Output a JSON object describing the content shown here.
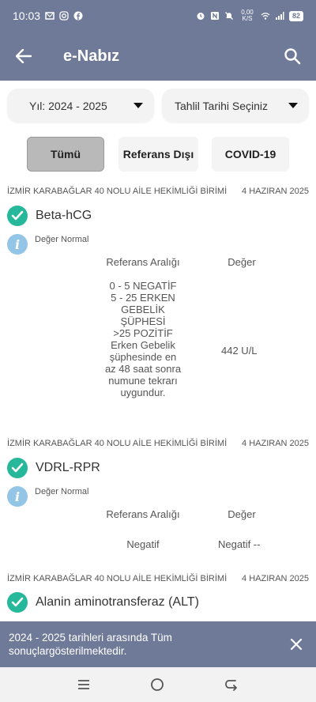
{
  "status": {
    "time": "10:03",
    "speed": "0,00 K/S",
    "battery": "82"
  },
  "app_bar": {
    "title": "e-Nabız"
  },
  "filters": {
    "year": "Yıl: 2024 - 2025",
    "date": "Tahlil Tarihi Seçiniz"
  },
  "tabs": [
    {
      "label": "Tümü",
      "active": true
    },
    {
      "label": "Referans Dışı",
      "active": false
    },
    {
      "label": "COVID-19",
      "active": false
    }
  ],
  "results": [
    {
      "clinic": "İZMİR KARABAĞLAR 40 NOLU AİLE HEKİMLİĞİ BİRİMİ",
      "date": "4 HAZIRAN 2025",
      "test": "Beta-hCG",
      "status": "Değer Normal",
      "ref_header": "Referans Aralığı",
      "value_header": "Değer",
      "reference": "0 - 5  NEGATİF\n5 - 25 ERKEN\nGEBELİK\nŞÜPHESİ\n>25    POZİTİF\nErken Gebelik\nşüphesinde en\naz 48 saat sonra\nnumune tekrarı\nuygundur.",
      "value": "442  U/L"
    },
    {
      "clinic": "İZMİR KARABAĞLAR 40 NOLU AİLE HEKİMLİĞİ BİRİMİ",
      "date": "4 HAZIRAN 2025",
      "test": "VDRL-RPR",
      "status": "Değer Normal",
      "ref_header": "Referans Aralığı",
      "value_header": "Değer",
      "reference": "Negatif",
      "value": "Negatif  --"
    },
    {
      "clinic": "İZMİR KARABAĞLAR 40 NOLU AİLE HEKİMLİĞİ BİRİMİ",
      "date": "4 HAZIRAN 2025",
      "test": "Alanin aminotransferaz (ALT)"
    }
  ],
  "snackbar": {
    "message_line1": "2024 - 2025 tarihleri arasında Tüm",
    "message_line2": "sonuçlargösterilmektedir."
  },
  "colors": {
    "primary": "#6f7a99",
    "check": "#26b89a",
    "info": "#93c6e6"
  }
}
